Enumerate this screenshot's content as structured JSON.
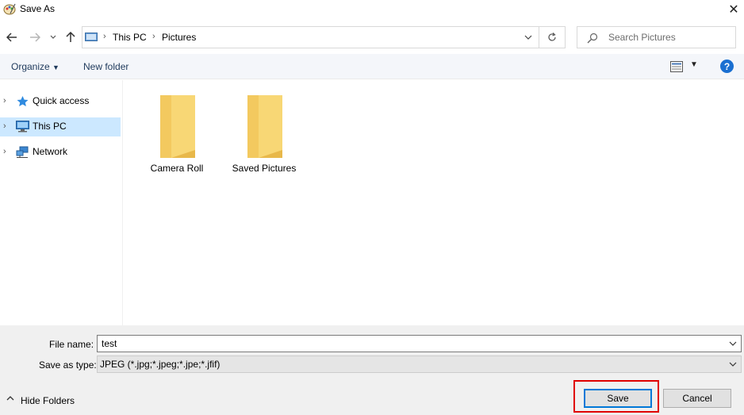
{
  "window": {
    "title": "Save As",
    "close_icon": "close-icon"
  },
  "nav": {
    "back_icon": "back-arrow-icon",
    "forward_icon": "forward-arrow-icon",
    "recent_icon": "chevron-down-icon",
    "up_icon": "up-arrow-icon"
  },
  "address": {
    "crumbs": [
      "This PC",
      "Pictures"
    ],
    "refresh_icon": "refresh-icon"
  },
  "search": {
    "placeholder": "Search Pictures"
  },
  "commands": {
    "organize": "Organize",
    "new_folder": "New folder",
    "help": "?"
  },
  "navpane": {
    "items": [
      {
        "label": "Quick access",
        "icon": "star-icon",
        "selected": false
      },
      {
        "label": "This PC",
        "icon": "computer-icon",
        "selected": true
      },
      {
        "label": "Network",
        "icon": "network-icon",
        "selected": false
      }
    ]
  },
  "folders": [
    {
      "name": "Camera Roll"
    },
    {
      "name": "Saved Pictures"
    }
  ],
  "form": {
    "file_name_label": "File name:",
    "file_name_value": "test",
    "save_type_label": "Save as type:",
    "save_type_value": "JPEG (*.jpg;*.jpeg;*.jpe;*.jfif)"
  },
  "footer": {
    "hide_folders": "Hide Folders",
    "save": "Save",
    "cancel": "Cancel"
  },
  "colors": {
    "selection": "#cce8ff",
    "accent": "#0078d7",
    "highlight_box": "#e00000",
    "folder": "#f8d775"
  }
}
